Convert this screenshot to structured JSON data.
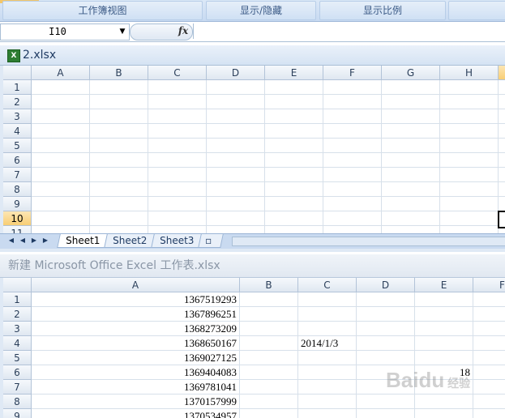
{
  "ribbon": {
    "groups": [
      "工作簿视图",
      "显示/隐藏",
      "显示比例"
    ]
  },
  "formula_bar": {
    "name_box": "I10",
    "fx_label": "fx",
    "value": ""
  },
  "window1": {
    "title": "2.xlsx",
    "columns": [
      "A",
      "B",
      "C",
      "D",
      "E",
      "F",
      "G",
      "H"
    ],
    "rows": [
      "1",
      "2",
      "3",
      "4",
      "5",
      "6",
      "7",
      "8",
      "9",
      "10"
    ],
    "partial_row": "11",
    "active_row": "10",
    "sheets": [
      "Sheet1",
      "Sheet2",
      "Sheet3"
    ],
    "active_sheet": "Sheet1"
  },
  "window2": {
    "title": "新建 Microsoft Office Excel 工作表.xlsx",
    "columns": [
      "A",
      "B",
      "C",
      "D",
      "E",
      "F"
    ],
    "rows": [
      {
        "n": "1",
        "A": "1367519293",
        "C": "",
        "E": ""
      },
      {
        "n": "2",
        "A": "1367896251",
        "C": "",
        "E": ""
      },
      {
        "n": "3",
        "A": "1368273209",
        "C": "",
        "E": ""
      },
      {
        "n": "4",
        "A": "1368650167",
        "C": "2014/1/3",
        "E": ""
      },
      {
        "n": "5",
        "A": "1369027125",
        "C": "",
        "E": ""
      },
      {
        "n": "6",
        "A": "1369404083",
        "C": "",
        "E": "18"
      },
      {
        "n": "7",
        "A": "1369781041",
        "C": "",
        "E": ""
      },
      {
        "n": "8",
        "A": "1370157999",
        "C": "",
        "E": ""
      },
      {
        "n": "9",
        "A": "1370534957",
        "C": "",
        "E": ""
      }
    ]
  },
  "watermark": "Baidu 经验",
  "colors": {
    "accent": "#f8ce75",
    "header_bg": "#dfe7f1",
    "title_text": "#1f3b63"
  }
}
